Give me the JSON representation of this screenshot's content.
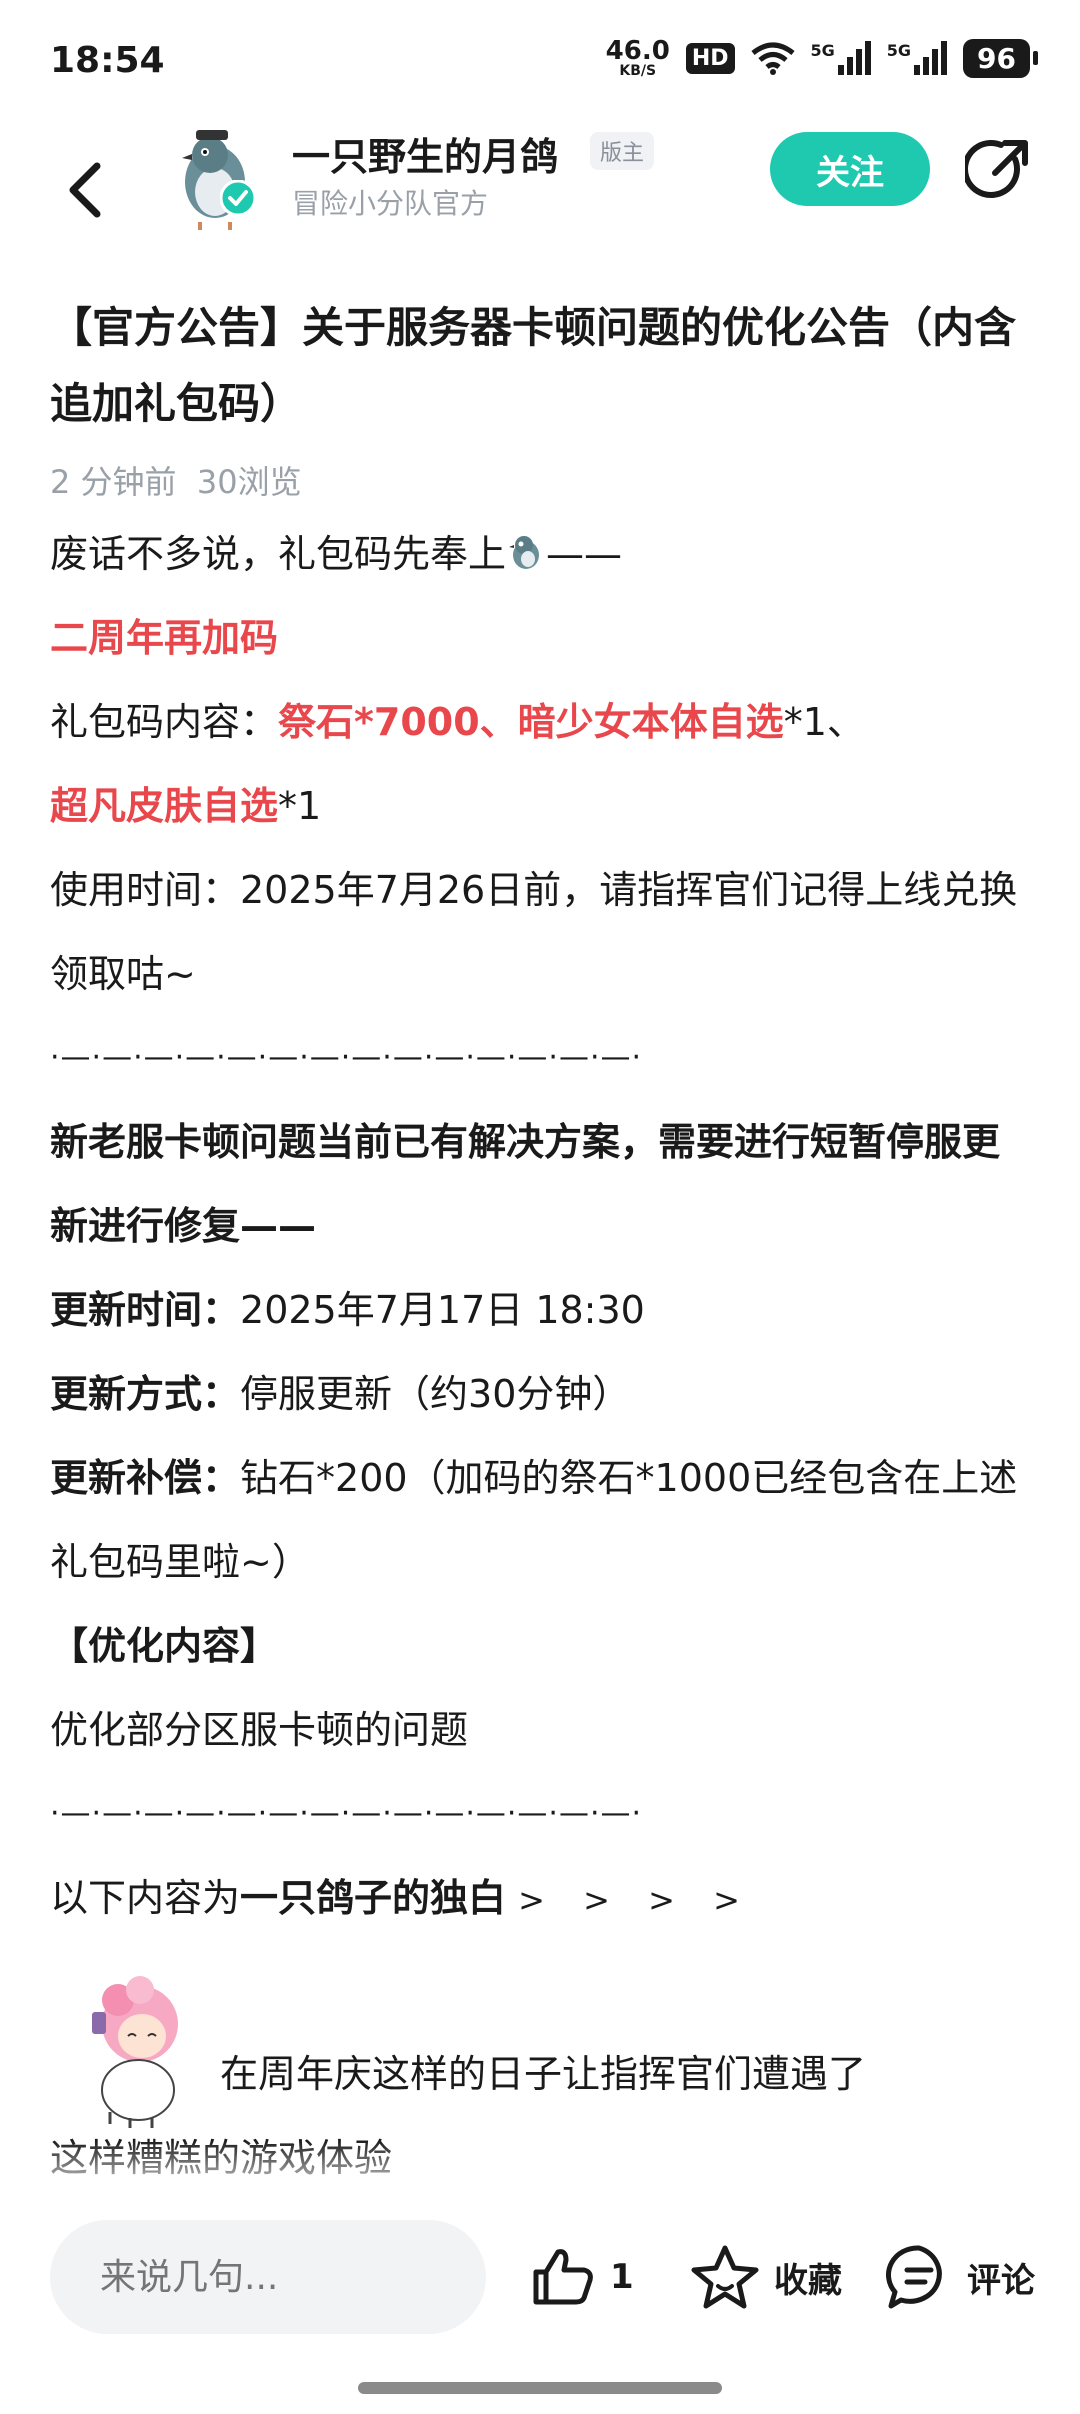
{
  "status": {
    "time": "18:54",
    "net_speed": "46.0",
    "net_unit": "KB/S",
    "hd": "HD",
    "signal1": "5G",
    "signal2": "5G",
    "battery": "96"
  },
  "header": {
    "author_name": "一只野生的月鸽",
    "mod_badge": "版主",
    "author_sub": "冒险小分队官方",
    "follow_label": "关注",
    "icons": {
      "back": "back-arrow-icon",
      "share": "share-icon",
      "verified": "verified-icon"
    }
  },
  "article": {
    "title": "【官方公告】关于服务器卡顿问题的优化公告（内含追加礼包码）",
    "time_ago": "2 分钟前",
    "views": "30浏览",
    "intro": "废话不多说，礼包码先奉上",
    "intro_tail": "——",
    "extra_code_heading": "二周年再加码",
    "gift_label": "礼包码内容：",
    "gift_item1": "祭石*7000",
    "sep1": "、",
    "gift_item2": "暗少女本体自选",
    "gift_item2_qty": "*1、",
    "gift_item3": "超凡皮肤自选",
    "gift_item3_qty": "*1",
    "use_time": "使用时间：2025年7月26日前，请指挥官们记得上线兑换领取咕~",
    "divider": "·—·—·—·—·—·—·—·—·—·—·—·—·—·—·",
    "issue_line": "新老服卡顿问题当前已有解决方案，需要进行短暂停服更新进行修复——",
    "update_time_label": "更新时间：",
    "update_time_value": "2025年7月17日 18:30",
    "update_method_label": "更新方式：",
    "update_method_value": "停服更新（约30分钟）",
    "update_comp_label": "更新补偿：",
    "update_comp_value": "钻石*200（加码的祭石*1000已经包含在上述礼包码里啦~）",
    "optimize_heading": "【优化内容】",
    "optimize_item": "优化部分区服卡顿的问题",
    "monologue_prefix": "以下内容为",
    "monologue_bold": "一只鸽子的独白",
    "monologue_arrows": "> > > >",
    "sticker_text": "在周年庆这样的日子让指挥官们遭遇了",
    "sticker_text2": "这样糟糕的游戏体验"
  },
  "bottom": {
    "comment_placeholder": "来说几句...",
    "like_count": "1",
    "fav_label": "收藏",
    "comment_label": "评论"
  },
  "colors": {
    "accent": "#1ec9b0",
    "highlight_red": "#e8474c",
    "muted": "#9aa0a8"
  }
}
